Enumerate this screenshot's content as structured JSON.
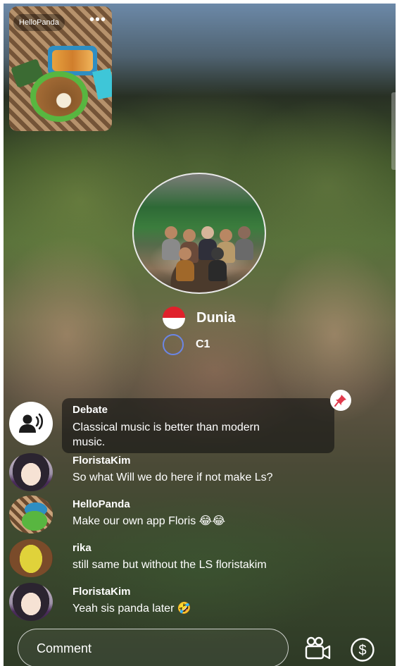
{
  "pip": {
    "label": "HelloPanda",
    "more_icon": "more-horizontal-icon",
    "more_glyph": "•••"
  },
  "room": {
    "title": "Dunia",
    "subtitle": "C1",
    "flag_icon": "indonesia-flag-icon",
    "ring_icon": "level-ring-icon",
    "ring_color": "#6b86e6"
  },
  "pinned": {
    "name": "Debate",
    "text_line1": "Classical music is better than modern",
    "text_line2": "music.",
    "icon": "debate-speaker-icon",
    "pin_icon": "pin-icon",
    "pin_color": "#e23a4d"
  },
  "messages": [
    {
      "name": "FloristaKim",
      "text": "So what Will we do here if not make Ls?"
    },
    {
      "name": "HelloPanda",
      "text": "Make our own app Floris 😂😂"
    },
    {
      "name": "rika",
      "text": "still same but without the LS floristakim"
    },
    {
      "name": "FloristaKim",
      "text": "Yeah sis panda later 🤣"
    }
  ],
  "composer": {
    "placeholder": "Comment",
    "camera_icon": "video-camera-icon",
    "gift_icon": "dollar-coin-icon"
  }
}
